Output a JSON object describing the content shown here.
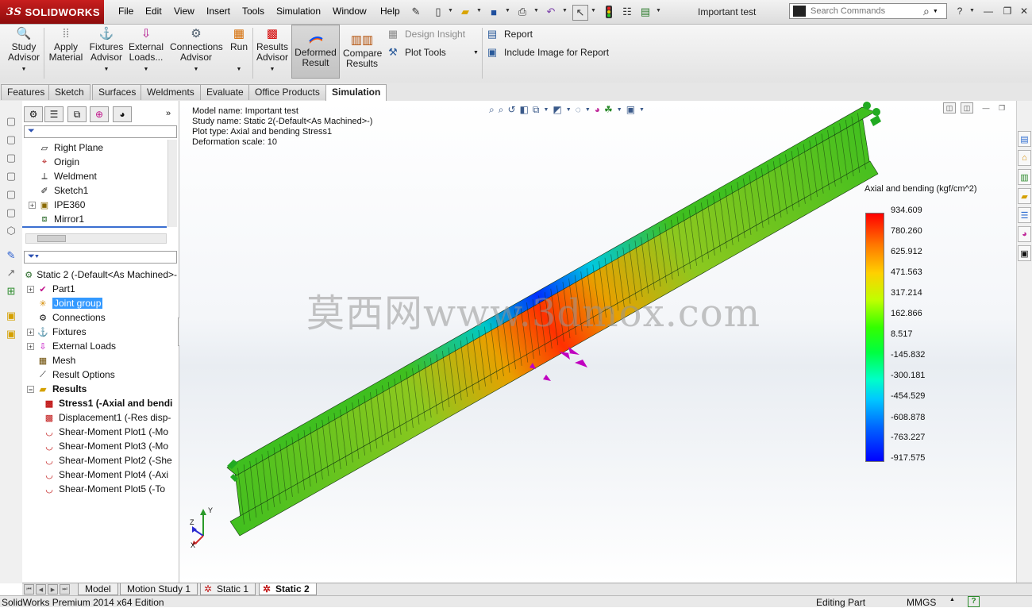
{
  "app": {
    "logo_text": "SOLIDWORKS",
    "logo_prefix": "3S",
    "document_title": "Important test"
  },
  "menu": [
    "File",
    "Edit",
    "View",
    "Insert",
    "Tools",
    "Simulation",
    "Window",
    "Help"
  ],
  "search": {
    "placeholder": "Search Commands"
  },
  "command_manager": {
    "study_advisor": {
      "line1": "Study",
      "line2": "Advisor"
    },
    "apply_material": {
      "line1": "Apply",
      "line2": "Material"
    },
    "fixtures_advisor": {
      "line1": "Fixtures",
      "line2": "Advisor"
    },
    "external_loads": {
      "line1": "External",
      "line2": "Loads..."
    },
    "connections_advisor": {
      "line1": "Connections",
      "line2": "Advisor"
    },
    "run": {
      "line1": "Run"
    },
    "results_advisor": {
      "line1": "Results",
      "line2": "Advisor"
    },
    "deformed_result": {
      "line1": "Deformed",
      "line2": "Result"
    },
    "compare_results": {
      "line1": "Compare",
      "line2": "Results"
    },
    "design_insight": "Design Insight",
    "plot_tools": "Plot Tools",
    "report": "Report",
    "include_image": "Include Image for Report"
  },
  "tabs": [
    "Features",
    "Sketch",
    "Surfaces",
    "Weldments",
    "Evaluate",
    "Office Products",
    "Simulation"
  ],
  "feature_tree": {
    "items": [
      {
        "label": "Right Plane"
      },
      {
        "label": "Origin"
      },
      {
        "label": "Weldment"
      },
      {
        "label": "Sketch1"
      },
      {
        "label": "IPE360"
      },
      {
        "label": "Mirror1"
      }
    ]
  },
  "sim_tree": {
    "root": "Static 2 (-Default<As Machined>-",
    "items": [
      {
        "label": "Part1"
      },
      {
        "label": "Joint group"
      },
      {
        "label": "Connections"
      },
      {
        "label": "Fixtures"
      },
      {
        "label": "External Loads"
      },
      {
        "label": "Mesh"
      },
      {
        "label": "Result Options"
      },
      {
        "label": "Results"
      },
      {
        "label": "Stress1 (-Axial and bendi"
      },
      {
        "label": "Displacement1 (-Res disp-"
      },
      {
        "label": "Shear-Moment Plot1 (-Mo"
      },
      {
        "label": "Shear-Moment Plot3 (-Mo"
      },
      {
        "label": "Shear-Moment Plot2 (-She"
      },
      {
        "label": "Shear-Moment Plot4 (-Axi"
      },
      {
        "label": "Shear-Moment Plot5 (-To"
      }
    ]
  },
  "viewport_info": {
    "model_name": "Model name: Important test",
    "study_name": "Study name: Static 2(-Default<As Machined>-)",
    "plot_type": "Plot type: Axial and bending Stress1",
    "deformation_scale": "Deformation scale: 10"
  },
  "legend": {
    "title": "Axial and bending (kgf/cm^2)",
    "values": [
      "934.609",
      "780.260",
      "625.912",
      "471.563",
      "317.214",
      "162.866",
      "8.517",
      "-145.832",
      "-300.181",
      "-454.529",
      "-608.878",
      "-763.227",
      "-917.575"
    ]
  },
  "watermark": "莫西网www.3dmox.com",
  "triad": {
    "x": "X",
    "y": "Y",
    "z": "Z"
  },
  "bottom_tabs": [
    "Model",
    "Motion Study 1",
    "Static 1",
    "Static 2"
  ],
  "status": {
    "edition": "SolidWorks Premium 2014 x64 Edition",
    "mode": "Editing Part",
    "units": "MMGS",
    "help": "?"
  },
  "colors": {
    "title_red": "#b01515",
    "selection_blue": "#3399ff",
    "load_magenta": "#c000c0",
    "fixture_green": "#22aa22"
  }
}
